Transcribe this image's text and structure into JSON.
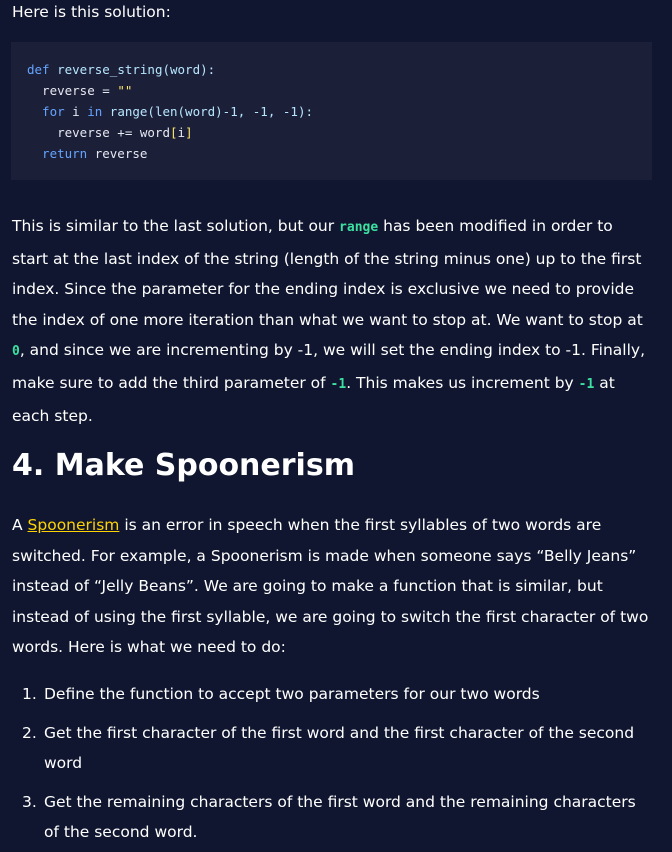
{
  "intro": "Here is this solution:",
  "code": {
    "lines": [
      [
        {
          "t": "def ",
          "c": "kw"
        },
        {
          "t": "reverse_string(word):",
          "c": "bi"
        }
      ],
      [
        {
          "t": "  reverse = ",
          "c": ""
        },
        {
          "t": "\"\"",
          "c": "str"
        }
      ],
      [
        {
          "t": "  for ",
          "c": "kw"
        },
        {
          "t": "i ",
          "c": ""
        },
        {
          "t": "in ",
          "c": "kw"
        },
        {
          "t": "range(len(word)-1, -1, -1):",
          "c": "bi"
        }
      ],
      [
        {
          "t": "    reverse += word",
          "c": ""
        },
        {
          "t": "[",
          "c": "brk"
        },
        {
          "t": "i",
          "c": ""
        },
        {
          "t": "]",
          "c": "brk"
        }
      ],
      [
        {
          "t": "  return ",
          "c": "kw"
        },
        {
          "t": "reverse",
          "c": ""
        }
      ]
    ]
  },
  "explanation": {
    "l1_a": "This is similar to the last solution, but our ",
    "l1_code": "range",
    "l1_b": " has been modified in order to",
    "l2": "start at the last index of the string (length of the string minus one) up to the first",
    "l3": "index. Since the parameter for the ending index is exclusive we need to provide",
    "l4": "the index of one more iteration than what we want to stop at. We want to stop at",
    "l5_code": "0",
    "l5_b": ", and since we are incrementing by -1, we will set the ending index to -1. Finally,",
    "l6_a": "make sure to add the third parameter of ",
    "l6_code": "-1",
    "l6_b": ". This makes us increment by ",
    "l6_code2": "-1",
    "l6_c": " at",
    "l7": "each step."
  },
  "section": {
    "heading": "4. Make Spoonerism",
    "p_a": "A ",
    "link": "Spoonerism",
    "p_b": " is an error in speech when the first syllables of two words are",
    "l2": "switched. For example, a Spoonerism is made when someone says “Belly Jeans”",
    "l3": "instead of “Jelly Beans”. We are going to make a function that is similar, but",
    "l4": "instead of using the first syllable, we are going to switch the first character of two",
    "l5": "words. Here is what we need to do:"
  },
  "steps": [
    {
      "marker": "1.",
      "lines": [
        "Define the function to accept two parameters for our two words"
      ]
    },
    {
      "marker": "2.",
      "lines": [
        "Get the first character of the first word and the first character of the second",
        "word"
      ]
    },
    {
      "marker": "3.",
      "lines": [
        "Get the remaining characters of the first word and the remaining characters",
        "of the second word."
      ]
    }
  ]
}
